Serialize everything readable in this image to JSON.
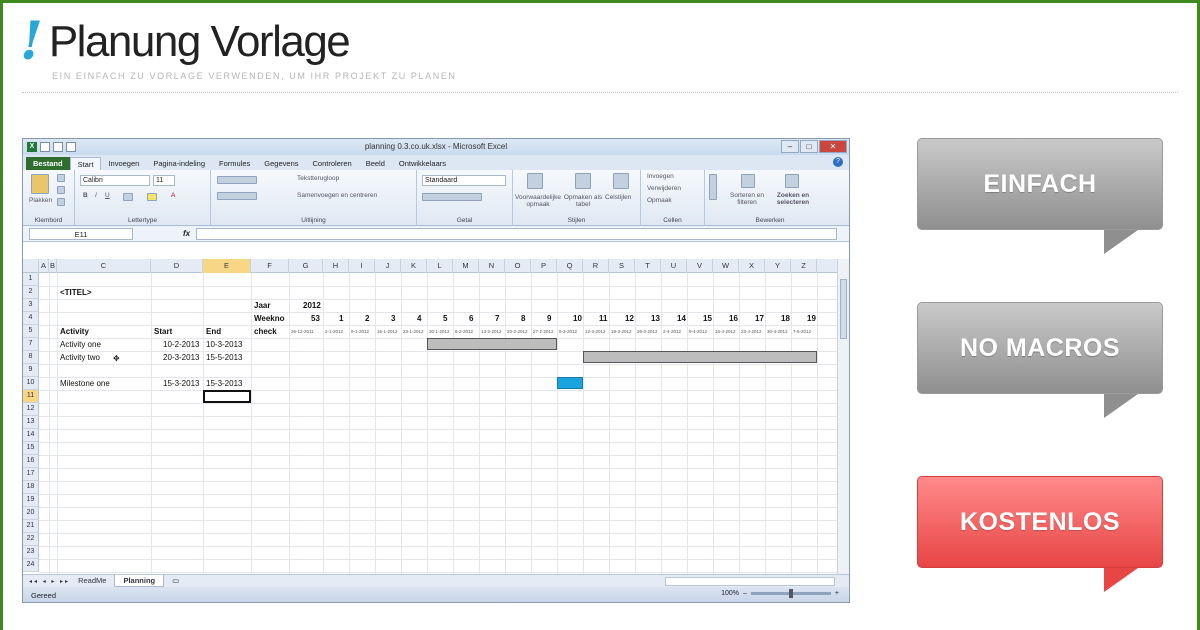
{
  "header": {
    "bang": "!",
    "title": "Planung Vorlage",
    "tagline": "EIN EINFACH ZU VORLAGE VERWENDEN, UM IHR PROJEKT ZU PLANEN"
  },
  "excel": {
    "window_title": "planning 0.3.co.uk.xlsx - Microsoft Excel",
    "tabs": [
      "Bestand",
      "Start",
      "Invoegen",
      "Pagina-indeling",
      "Formules",
      "Gegevens",
      "Controleren",
      "Beeld",
      "Ontwikkelaars"
    ],
    "ribbon": {
      "klembord_label": "Klembord",
      "plakken_label": "Plakken",
      "font_name": "Calibri",
      "font_size": "11",
      "lettertype_label": "Lettertype",
      "tekstterugloop": "Tekstterugloop",
      "samenvoegen": "Samenvoegen en centreren",
      "uitlijning_label": "Uitlijning",
      "number_format": "Standaard",
      "getal_label": "Getal",
      "voorwaardelijke": "Voorwaardelijke opmaak",
      "opmaken_tabel": "Opmaken als tabel",
      "celstijlen": "Celstijlen",
      "stijlen_label": "Stijlen",
      "invoegen": "Invoegen",
      "verwijderen": "Verwijderen",
      "opmaak": "Opmaak",
      "cellen_label": "Cellen",
      "sorteren": "Sorteren en filteren",
      "zoeken": "Zoeken en selecteren",
      "bewerken_label": "Bewerken"
    },
    "name_box": "E11",
    "fx": "fx",
    "columns": [
      "A",
      "B",
      "C",
      "D",
      "E",
      "F",
      "G",
      "H",
      "I",
      "J",
      "K",
      "L",
      "M",
      "N",
      "O",
      "P",
      "Q",
      "R",
      "S",
      "T",
      "U",
      "V",
      "W",
      "X",
      "Y",
      "Z"
    ],
    "rows": [
      "1",
      "2",
      "3",
      "4",
      "5",
      "7",
      "8",
      "9",
      "10",
      "11",
      "12",
      "13",
      "14",
      "15",
      "16",
      "17",
      "18",
      "19",
      "20",
      "21",
      "22",
      "23",
      "24"
    ],
    "cells": {
      "titel": "<TITEL>",
      "jaar": "Jaar",
      "year": "2012",
      "weekno": "Weekno",
      "weekno_val": "53",
      "check": "check",
      "activity": "Activity",
      "start": "Start",
      "end": "End",
      "act1": "Activity one",
      "act1_start": "10-2-2013",
      "act1_end": "10-3-2013",
      "act2": "Activity two",
      "act2_start": "20-3-2013",
      "act2_end": "15-5-2013",
      "ms1": "Milestone one",
      "ms1_start": "15-3-2013",
      "ms1_end": "15-3-2013"
    },
    "week_numbers": [
      "1",
      "2",
      "3",
      "4",
      "5",
      "6",
      "7",
      "8",
      "9",
      "10",
      "11",
      "12",
      "13",
      "14",
      "15",
      "16",
      "17",
      "18",
      "19"
    ],
    "week_dates": [
      "26-12-2011",
      "2-1-2012",
      "9-1-2012",
      "16-1-2012",
      "23-1-2012",
      "30-1-2012",
      "6-2-2012",
      "13-2-2012",
      "20-2-2012",
      "27-2-2012",
      "5-3-2012",
      "12-3-2012",
      "19-3-2012",
      "26-3-2012",
      "2-4-2012",
      "9-4-2012",
      "16-4-2012",
      "23-4-2012",
      "30-4-2012",
      "7-5-2012"
    ],
    "sheet_tabs": [
      "ReadMe",
      "Planning"
    ],
    "status": "Gereed",
    "zoom": "100%"
  },
  "buttons": {
    "einfach": "EINFACH",
    "no_macros": "NO MACROS",
    "kostenlos": "KOSTENLOS"
  },
  "colors": {
    "frame": "#3f8a1f",
    "accent": "#2aa7d9",
    "milestone": "#1aa3dd",
    "red": "#e84545"
  }
}
